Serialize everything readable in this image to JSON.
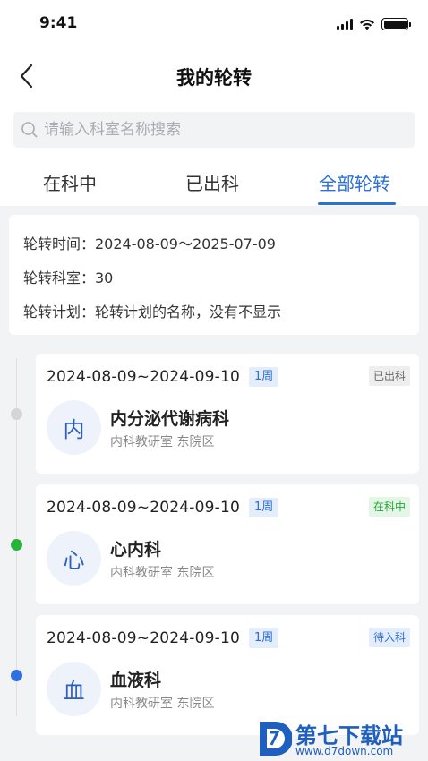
{
  "status_bar": {
    "time": "9:41"
  },
  "nav": {
    "title": "我的轮转"
  },
  "search": {
    "placeholder": "请输入科室名称搜索"
  },
  "tabs": [
    {
      "label": "在科中",
      "active": false
    },
    {
      "label": "已出科",
      "active": false
    },
    {
      "label": "全部轮转",
      "active": true
    }
  ],
  "summary": {
    "time": "轮转时间：2024-08-09～2025-07-09",
    "department": "轮转科室：30",
    "plan": "轮转计划：轮转计划的名称，没有不显示"
  },
  "rotations": [
    {
      "date_range": "2024-08-09~2024-09-10",
      "duration": "1周",
      "status": "已出科",
      "avatar": "内",
      "name": "内分泌代谢病科",
      "sub": "内科教研室 东院区",
      "dot_color": "#d3d5d9",
      "status_bg": "#eeeeee",
      "status_fg": "#666666"
    },
    {
      "date_range": "2024-08-09~2024-09-10",
      "duration": "1周",
      "status": "在科中",
      "avatar": "心",
      "name": "心内科",
      "sub": "内科教研室 东院区",
      "dot_color": "#27b23a",
      "status_bg": "#e4f6e6",
      "status_fg": "#27a83a"
    },
    {
      "date_range": "2024-08-09~2024-09-10",
      "duration": "1周",
      "status": "待入科",
      "avatar": "血",
      "name": "血液科",
      "sub": "内科教研室 东院区",
      "dot_color": "#2f6fe0",
      "status_bg": "#e3edfb",
      "status_fg": "#2c6fd9"
    }
  ],
  "watermark": {
    "title": "第七下载站",
    "url": "www.d7down.com"
  },
  "colors": {
    "accent": "#2c6fd9"
  }
}
